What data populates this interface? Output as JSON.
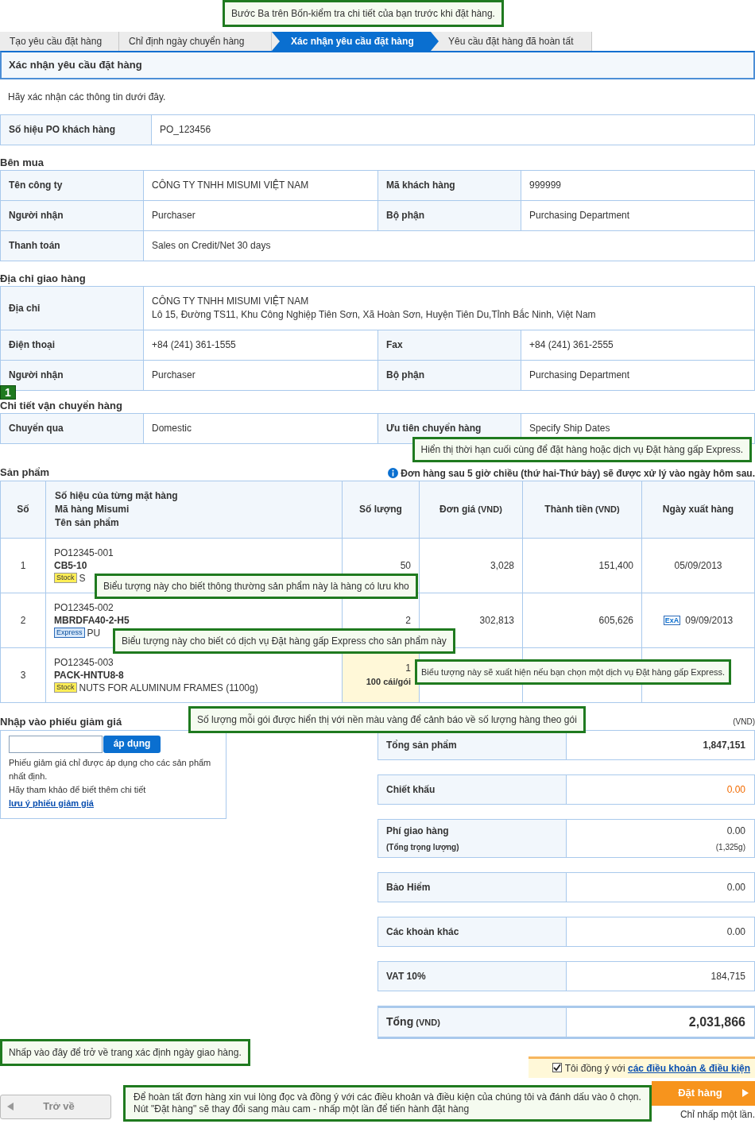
{
  "step_callout": "Bước Ba trên Bốn-kiểm tra chi tiết của bạn trước khi đặt hàng.",
  "steps": [
    {
      "label": "Tạo yêu cầu đặt hàng",
      "selected": false
    },
    {
      "label": "Chỉ định ngày chuyển hàng",
      "selected": false
    },
    {
      "label": "Xác nhận yêu cầu đặt hàng",
      "selected": true
    },
    {
      "label": "Yêu cầu đặt hàng đã hoàn tất",
      "selected": false
    }
  ],
  "page_title": "Xác nhận yêu cầu đặt hàng",
  "intro": "Hãy xác nhận các thông tin dưới đây.",
  "po": {
    "label": "Số hiệu PO khách hàng",
    "value": "PO_123456"
  },
  "buyer": {
    "heading": "Bên mua",
    "rows": [
      {
        "cells": [
          {
            "label": "Tên công ty",
            "value": "CÔNG TY TNHH MISUMI VIỆT NAM"
          },
          {
            "label": "Mã khách hàng",
            "value": "999999"
          }
        ]
      },
      {
        "cells": [
          {
            "label": "Người nhận",
            "value": "Purchaser"
          },
          {
            "label": "Bộ phận",
            "value": "Purchasing Department"
          }
        ]
      },
      {
        "cells": [
          {
            "label": "Thanh toán",
            "value": "Sales on Credit/Net 30 days"
          }
        ]
      }
    ]
  },
  "delivery": {
    "heading": "Địa chỉ giao hàng",
    "rows": [
      {
        "cells": [
          {
            "label": "Địa chỉ",
            "value": "CÔNG TY TNHH MISUMI VIỆT NAM\nLô 15, Đường TS11, Khu Công Nghiệp Tiên Sơn, Xã Hoàn Sơn, Huyện Tiên Du,Tỉnh Bắc Ninh, Việt Nam"
          }
        ]
      },
      {
        "cells": [
          {
            "label": "Điện thoại",
            "value": "+84 (241) 361-1555"
          },
          {
            "label": "Fax",
            "value": "+84 (241) 361-2555"
          }
        ]
      },
      {
        "cells": [
          {
            "label": "Người nhận",
            "value": "Purchaser"
          },
          {
            "label": "Bộ phận",
            "value": "Purchasing Department"
          }
        ]
      }
    ]
  },
  "step_marker": "1",
  "shipping": {
    "heading": "Chi tiết vận chuyển hàng",
    "rows": [
      {
        "cells": [
          {
            "label": "Chuyển qua",
            "value": "Domestic"
          },
          {
            "label": "Ưu tiên chuyển hàng",
            "value": "Specify Ship Dates"
          }
        ]
      }
    ]
  },
  "shipping_callout": "Hiển thị thời hạn cuối cùng để đặt hàng hoặc dịch vụ Đặt hàng gấp Express.",
  "products": {
    "heading": "Sản phẩm",
    "notice": "Đơn hàng sau 5 giờ chiều (thứ hai-Thứ bảy) sẽ được xử lý vào ngày hôm sau.",
    "columns": [
      {
        "lines": [
          "Số"
        ]
      },
      {
        "lines": [
          "Số hiệu của từng mặt hàng",
          "Mã hàng Misumi",
          "Tên sản phẩm"
        ]
      },
      {
        "lines": [
          "Số lượng"
        ]
      },
      {
        "lines": [
          "Đơn giá"
        ],
        "unit": "(VND)"
      },
      {
        "lines": [
          "Thành tiền"
        ],
        "unit": "(VND)"
      },
      {
        "lines": [
          "Ngày xuất hàng"
        ]
      }
    ],
    "rows": [
      {
        "no": "1",
        "po_number": "PO12345-001",
        "part_number": "CB5-10",
        "badge": {
          "kind": "stock",
          "label": "Stock"
        },
        "name": "S",
        "quantity": "50",
        "pack_warning": false,
        "unit_price": "3,028",
        "subtotal": "151,400",
        "ship_date": "05/09/2013",
        "callout": "Biểu tượng này cho biết thông thường sản phẩm này là hàng có lưu kho"
      },
      {
        "no": "2",
        "po_number": "PO12345-002",
        "part_number": "MBRDFA40-2-H5",
        "badge": {
          "kind": "express",
          "label": "Express"
        },
        "name": "PU",
        "quantity": "2",
        "pack_warning": false,
        "unit_price": "302,813",
        "subtotal": "605,626",
        "ship_mark": "ExA",
        "ship_date": "09/09/2013",
        "callout": "Biểu tượng này cho biết có dịch vụ Đặt hàng gấp Express cho sản phẩm này"
      },
      {
        "no": "3",
        "po_number": "PO12345-003",
        "part_number": "PACK-HNTU8-8",
        "badge": {
          "kind": "stock",
          "label": "Stock"
        },
        "name": "NUTS FOR ALUMINUM FRAMES (1100g)",
        "quantity": "1",
        "pack_note": "100 cái/gói",
        "pack_warning": true,
        "callout": "Biểu tượng này sẽ xuất hiện nếu bạn chọn một dịch vụ Đặt hàng gấp Express."
      }
    ]
  },
  "pack_callout": "Số lượng mỗi gói được hiển thị với nền màu vàng để cảnh báo về số lượng hàng theo gói",
  "coupon": {
    "heading": "Nhập vào phiếu giảm giá",
    "button": "áp dụng",
    "note": "Phiếu giảm giá chỉ được áp dụng cho các sản phẩm nhất định.",
    "help": "Hãy tham khảo để biết thêm chi tiết",
    "link": "lưu ý phiếu giảm giá"
  },
  "summary": {
    "unit": "(VND)",
    "rows": [
      {
        "kind": "normal",
        "label": "Tổng sản phẩm",
        "value": "1,847,151"
      },
      {
        "kind": "discount",
        "label": "Chiết khấu",
        "value": "0.00"
      },
      {
        "kind": "normal",
        "label": "Phí giao hàng",
        "sublabel": "(Tổng trọng lượng)",
        "value": "0.00",
        "subvalue": "(1,325g)"
      },
      {
        "kind": "normal",
        "label": "Bảo Hiểm",
        "value": "0.00"
      },
      {
        "kind": "normal",
        "label": "Các khoản khác",
        "value": "0.00"
      },
      {
        "kind": "normal",
        "label": "VAT 10%",
        "value": "184,715"
      },
      {
        "kind": "total",
        "label": "Tổng",
        "unit": "(VND)",
        "value": "2,031,866"
      }
    ]
  },
  "footer": {
    "back_callout": "Nhấp vào đây để trở về trang xác định ngày giao hàng.",
    "back": "Trở về",
    "agree": {
      "checked": true,
      "text": "Tôi đồng ý với",
      "link": "các điều khoản & điều kiện"
    },
    "order": "Đặt hàng",
    "once": "Chỉ nhấp một lần.",
    "order_callout": [
      "Để hoàn tất đơn hàng xin vui lòng đọc và đồng ý với các điều khoản và điều kiện của chúng tôi và đánh dấu vào ô chọn.",
      "Nút \"Đặt hàng\" sẽ thay đổi sang màu cam - nhấp một lần để tiến hành đặt hàng"
    ]
  }
}
